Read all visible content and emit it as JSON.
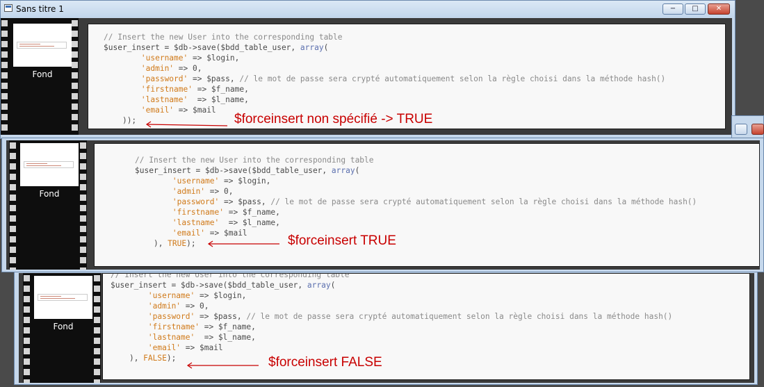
{
  "window": {
    "title": "Sans titre 1",
    "controls": {
      "minimize": "−",
      "maximize": "□",
      "close": "✕"
    }
  },
  "film": {
    "label": "Fond"
  },
  "code": {
    "comment": "// Insert the new User into the corresponding table",
    "line2_a": "$user_insert = $db->save($bdd_table_user, ",
    "array_kw": "array",
    "line2_b": "(",
    "k_username": "'username'",
    "v_username": " => $login,",
    "k_admin": "'admin'",
    "v_admin": " => 0,",
    "k_password": "'password'",
    "v_password": " => $pass, ",
    "c_password": "// le mot de passe sera crypté automatiquement selon la règle choisi dans la méthode hash()",
    "k_firstname": "'firstname'",
    "v_firstname": " => $f_name,",
    "k_lastname": "'lastname'",
    "v_lastname": "  => $l_name,",
    "k_email": "'email'",
    "v_email": " => $mail",
    "close1": "));",
    "close2_a": "), ",
    "true_kw": "TRUE",
    "close_end": ");",
    "false_kw": "FALSE"
  },
  "annotations": {
    "a1": "$forceinsert non spécifié -> TRUE",
    "a2": "$forceinsert TRUE",
    "a3": "$forceinsert FALSE"
  },
  "colors": {
    "annotation": "#c80000",
    "string": "#d07a1a",
    "keyword": "#5b6fae",
    "comment": "#8a8a8a"
  }
}
